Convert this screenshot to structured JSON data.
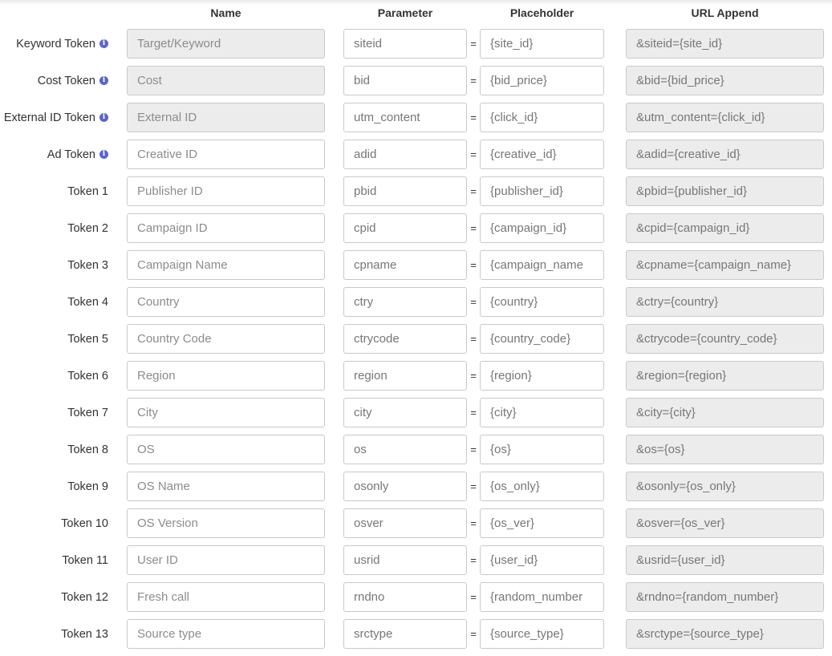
{
  "headers": {
    "name": "Name",
    "parameter": "Parameter",
    "placeholder": "Placeholder",
    "url_append": "URL Append"
  },
  "rows": [
    {
      "label": "Keyword Token",
      "info": true,
      "name": "Target/Keyword",
      "name_readonly": true,
      "param": "siteid",
      "placeholder": "{site_id}",
      "url": "&siteid={site_id}"
    },
    {
      "label": "Cost Token",
      "info": true,
      "name": "Cost",
      "name_readonly": true,
      "param": "bid",
      "placeholder": "{bid_price}",
      "url": "&bid={bid_price}"
    },
    {
      "label": "External ID Token",
      "info": true,
      "name": "External ID",
      "name_readonly": true,
      "param": "utm_content",
      "placeholder": "{click_id}",
      "url": "&utm_content={click_id}"
    },
    {
      "label": "Ad Token",
      "info": true,
      "name": "Creative ID",
      "name_readonly": false,
      "param": "adid",
      "placeholder": "{creative_id}",
      "url": "&adid={creative_id}"
    },
    {
      "label": "Token 1",
      "info": false,
      "name": "Publisher ID",
      "name_readonly": false,
      "param": "pbid",
      "placeholder": "{publisher_id}",
      "url": "&pbid={publisher_id}"
    },
    {
      "label": "Token 2",
      "info": false,
      "name": "Campaign ID",
      "name_readonly": false,
      "param": "cpid",
      "placeholder": "{campaign_id}",
      "url": "&cpid={campaign_id}"
    },
    {
      "label": "Token 3",
      "info": false,
      "name": "Campaign Name",
      "name_readonly": false,
      "param": "cpname",
      "placeholder": "{campaign_name",
      "url": "&cpname={campaign_name}"
    },
    {
      "label": "Token 4",
      "info": false,
      "name": "Country",
      "name_readonly": false,
      "param": "ctry",
      "placeholder": "{country}",
      "url": "&ctry={country}"
    },
    {
      "label": "Token 5",
      "info": false,
      "name": "Country Code",
      "name_readonly": false,
      "param": "ctrycode",
      "placeholder": "{country_code}",
      "url": "&ctrycode={country_code}"
    },
    {
      "label": "Token 6",
      "info": false,
      "name": "Region",
      "name_readonly": false,
      "param": "region",
      "placeholder": "{region}",
      "url": "&region={region}"
    },
    {
      "label": "Token 7",
      "info": false,
      "name": "City",
      "name_readonly": false,
      "param": "city",
      "placeholder": "{city}",
      "url": "&city={city}"
    },
    {
      "label": "Token 8",
      "info": false,
      "name": "OS",
      "name_readonly": false,
      "param": "os",
      "placeholder": "{os}",
      "url": "&os={os}"
    },
    {
      "label": "Token 9",
      "info": false,
      "name": "OS Name",
      "name_readonly": false,
      "param": "osonly",
      "placeholder": "{os_only}",
      "url": "&osonly={os_only}"
    },
    {
      "label": "Token 10",
      "info": false,
      "name": "OS Version",
      "name_readonly": false,
      "param": "osver",
      "placeholder": "{os_ver}",
      "url": "&osver={os_ver}"
    },
    {
      "label": "Token 11",
      "info": false,
      "name": "User ID",
      "name_readonly": false,
      "param": "usrid",
      "placeholder": "{user_id}",
      "url": "&usrid={user_id}"
    },
    {
      "label": "Token 12",
      "info": false,
      "name": "Fresh call",
      "name_readonly": false,
      "param": "rndno",
      "placeholder": "{random_number",
      "url": "&rndno={random_number}"
    },
    {
      "label": "Token 13",
      "info": false,
      "name": "Source type",
      "name_readonly": false,
      "param": "srctype",
      "placeholder": "{source_type}",
      "url": "&srctype={source_type}"
    }
  ],
  "separator": "=",
  "info_icon": "info-circle-icon",
  "colors": {
    "info_icon": "#5d64cc",
    "readonly_bg": "#ececec",
    "border": "#c9c9c9"
  }
}
